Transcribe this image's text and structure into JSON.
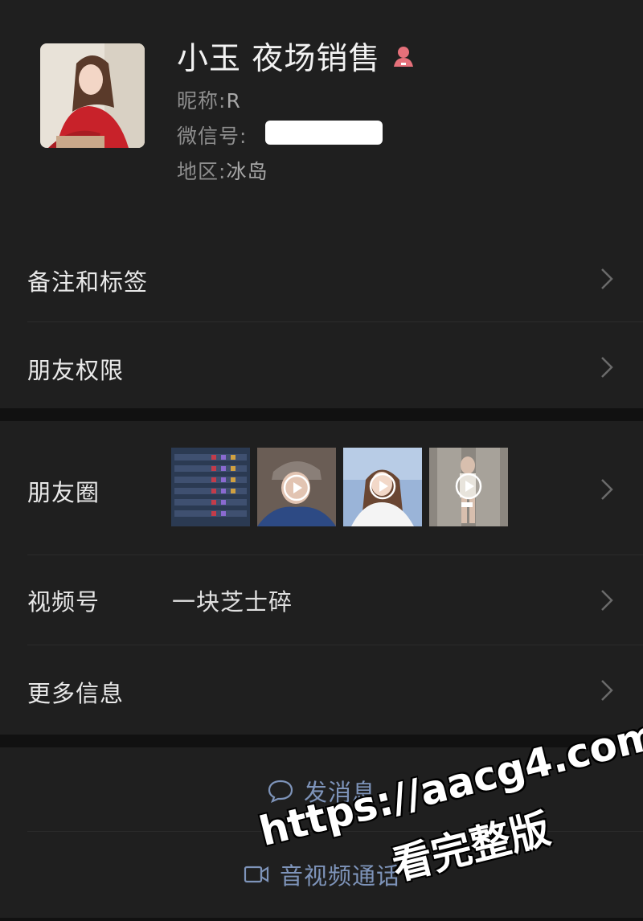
{
  "profile": {
    "name": "小玉 夜场销售",
    "nickname_label": "昵称:",
    "nickname": "R",
    "wechat_id_label": "微信号:",
    "region_label": "地区:",
    "region": "冰岛"
  },
  "rows": {
    "remarks_tags": "备注和标签",
    "friend_permissions": "朋友权限",
    "moments": "朋友圈",
    "channels": "视频号",
    "channels_value": "一块芝士碎",
    "more_info": "更多信息"
  },
  "actions": {
    "send_message": "发消息",
    "video_call": "音视频通话"
  },
  "watermark": {
    "url": "https://aacg4.com",
    "text": "看完整版"
  },
  "colors": {
    "background": "#111111",
    "card": "#1f1f1f",
    "action_link": "#7e94ba",
    "secondary_text": "#8e8e8e"
  }
}
